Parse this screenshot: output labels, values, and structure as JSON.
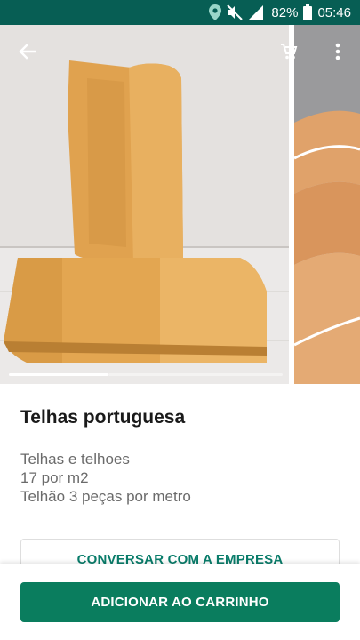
{
  "status_bar": {
    "battery_percent": "82%",
    "time": "05:46",
    "icons": [
      "location-icon",
      "mute-icon",
      "signal-icon",
      "battery-icon"
    ],
    "background": "#075e54"
  },
  "product": {
    "title": "Telhas portuguesa",
    "description_lines": [
      "Telhas e telhoes",
      "17 por m2",
      "Telhão 3 peças por metro"
    ]
  },
  "gallery": {
    "image_count": 2,
    "active_index": 0
  },
  "actions": {
    "chat_label": "CONVERSAR COM A EMPRESA",
    "add_to_cart_label": "ADICIONAR AO CARRINHO",
    "accent": "#0a7d5e"
  }
}
